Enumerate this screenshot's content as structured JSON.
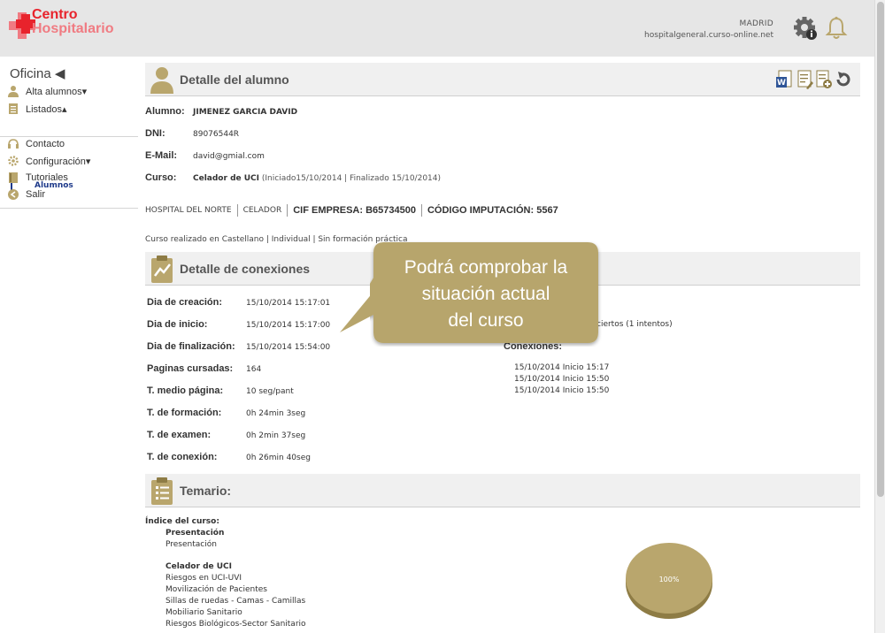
{
  "header": {
    "logo_line1": "Centro",
    "logo_line2": "Hospitalario",
    "city": "MADRID",
    "host": "hospitalgeneral.curso-online.net"
  },
  "sidebar": {
    "title": "Oficina ◀",
    "items": [
      {
        "label": "Alta alumnos▾",
        "icon": "user-icon"
      },
      {
        "label": "Listados▴",
        "icon": "list-icon"
      },
      {
        "label": "Contacto",
        "icon": "headset-icon"
      },
      {
        "label": "Configuración▾",
        "icon": "gear-icon"
      },
      {
        "label": "Tutoriales",
        "icon": "book-icon"
      },
      {
        "label": "Salir",
        "icon": "exit-icon"
      }
    ],
    "sub_item": "Alumnos"
  },
  "student": {
    "section_title": "Detalle del alumno",
    "alumno_label": "Alumno:",
    "alumno_value": "JIMENEZ GARCIA DAVID",
    "dni_label": "DNI:",
    "dni_value": "89076544R",
    "email_label": "E-Mail:",
    "email_value": "david@gmial.com",
    "curso_label": "Curso:",
    "curso_name": "Celador de UCI",
    "curso_dates": " (Iniciado15/10/2014 | Finalizado 15/10/2014)",
    "hospital": "HOSPITAL DEL NORTE",
    "role": "CELADOR",
    "cif": "CIF EMPRESA: B65734500",
    "codigo": "CÓDIGO IMPUTACIÓN: 5567",
    "course_note": "Curso realizado en Castellano | Individual | Sin formación práctica"
  },
  "connections": {
    "section_title": "Detalle de conexiones",
    "rows": [
      {
        "label": "Dia de creación:",
        "value": "15/10/2014 15:17:01"
      },
      {
        "label": "Dia de inicio:",
        "value": "15/10/2014 15:17:00"
      },
      {
        "label": "Dia de finalización:",
        "value": "15/10/2014 15:54:00"
      },
      {
        "label": "Paginas cursadas:",
        "value": "164"
      },
      {
        "label": "T. medio página:",
        "value": "10 seg/pant"
      },
      {
        "label": "T. de formación:",
        "value": "0h 24min 3seg"
      },
      {
        "label": "T. de examen:",
        "value": "0h 2min 37seg"
      },
      {
        "label": "T. de conexión:",
        "value": "0h 26min 40seg"
      }
    ],
    "exam_result_partial": "ciertos (1 intentos)",
    "conexiones_label": "Conexiones:",
    "log": [
      "15/10/2014 Inicio 15:17",
      "15/10/2014 Inicio 15:50",
      "15/10/2014 Inicio 15:50"
    ]
  },
  "temario": {
    "section_title": "Temario:",
    "index_label": "Índice del curso:",
    "group1_title": "Presentación",
    "group1_items": [
      "Presentación"
    ],
    "group2_title": "Celador de UCI",
    "group2_items": [
      "Riesgos en UCI-UVI",
      "Movilización de Pacientes",
      "Sillas de ruedas - Camas - Camillas",
      "Mobiliario Sanitario",
      "Riesgos Biológicos-Sector Sanitario"
    ],
    "pie_label": "100%",
    "pie_value": 100
  },
  "callout": {
    "line1": "Podrá comprobar la",
    "line2": "situación actual",
    "line3": "del curso"
  },
  "colors": {
    "accent_red": "#e8232c",
    "gold": "#b9a66d",
    "gold_dark": "#8e7c45",
    "callout_bg": "#b7a56c"
  }
}
